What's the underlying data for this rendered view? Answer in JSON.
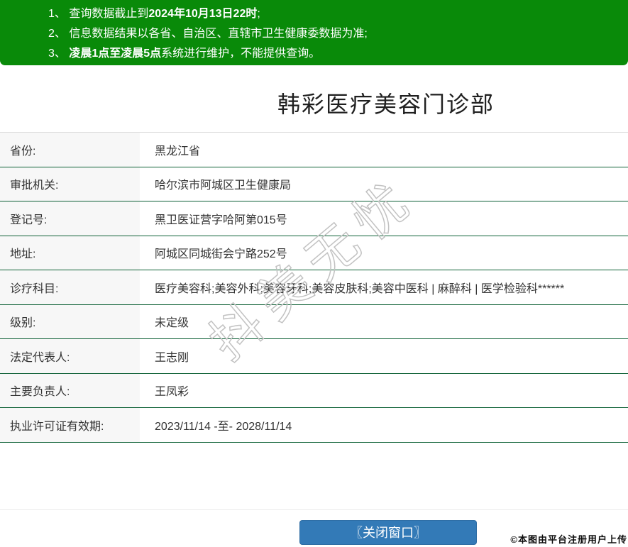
{
  "banner": {
    "notices": [
      {
        "prefix": "1、 查询数据截止到",
        "bold": "2024年10月13日22时",
        "suffix": ";"
      },
      {
        "prefix": "2、 信息数据结果以各省、自治区、直辖市卫生健康委数据为准;",
        "bold": "",
        "suffix": ""
      },
      {
        "prefix": "3、 ",
        "bold": "凌晨1点至凌晨5点",
        "suffix": "系统进行维护，不能提供查询。"
      }
    ]
  },
  "title": "韩彩医疗美容门诊部",
  "table": {
    "rows": [
      {
        "label": "省份:",
        "value": "黑龙江省"
      },
      {
        "label": "审批机关:",
        "value": "哈尔滨市阿城区卫生健康局"
      },
      {
        "label": "登记号:",
        "value": "黑卫医证营字哈阿第015号"
      },
      {
        "label": "地址:",
        "value": "阿城区同城街会宁路252号"
      },
      {
        "label": "诊疗科目:",
        "value": "医疗美容科;美容外科;美容牙科;美容皮肤科;美容中医科 | 麻醉科 | 医学检验科******"
      },
      {
        "label": "级别:",
        "value": "未定级"
      },
      {
        "label": "法定代表人:",
        "value": "王志刚"
      },
      {
        "label": "主要负责人:",
        "value": "王凤彩"
      },
      {
        "label": "执业许可证有效期:",
        "value": "2023/11/14 -至- 2028/11/14"
      }
    ]
  },
  "watermark": "抖美无忧",
  "close_button": "〖关闭窗口〗",
  "footer_note": "©本图由平台注册用户上传",
  "colors": {
    "banner_green": "#098a09",
    "row_divider_green": "#0e6136",
    "button_blue": "#337ab7",
    "label_bg": "#f7f7f7",
    "watermark_gray": "#c2c2c2"
  }
}
